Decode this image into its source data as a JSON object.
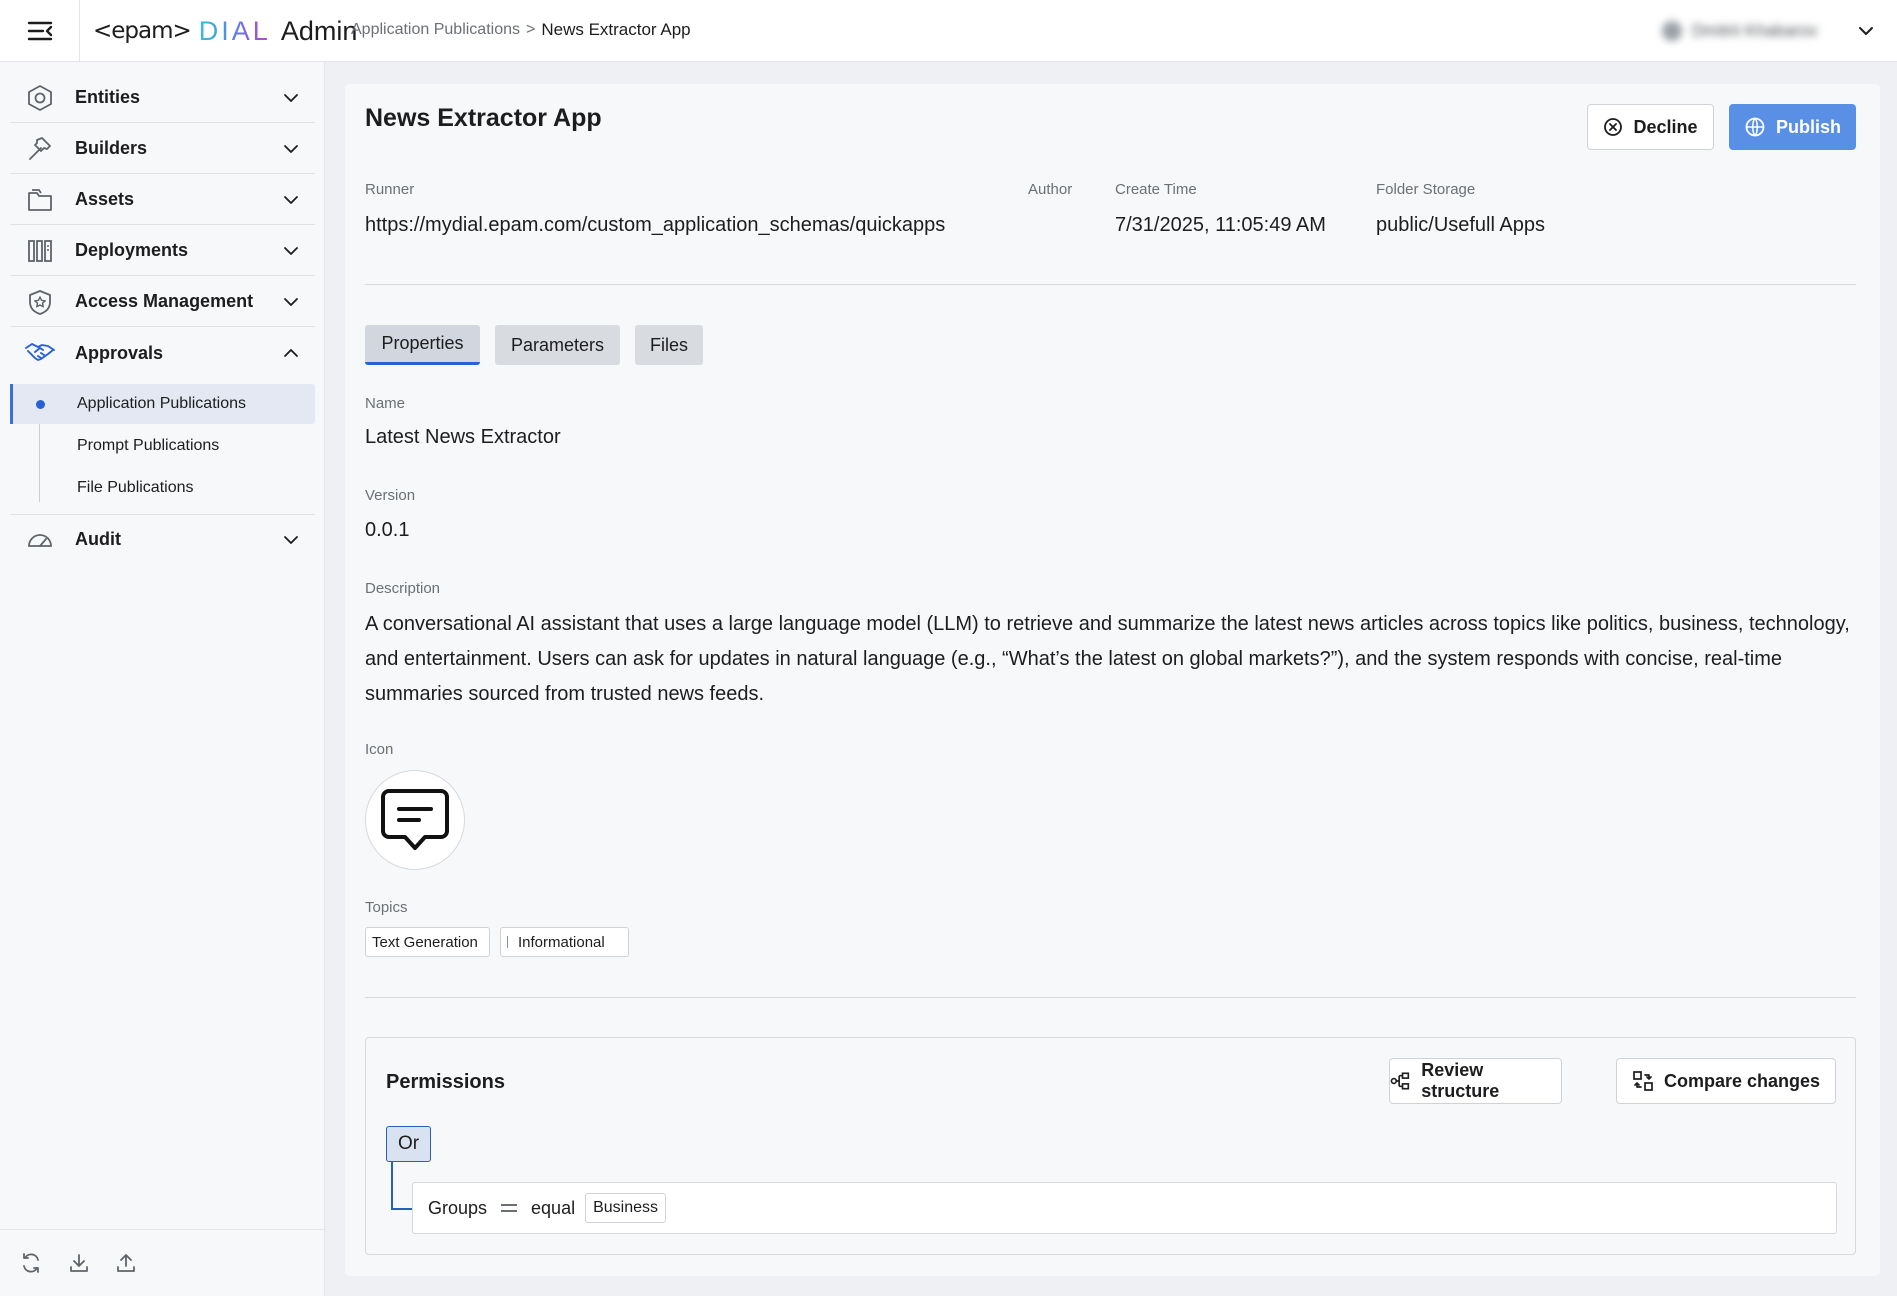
{
  "header": {
    "logo_epam": "<epam>",
    "logo_dial": "DIAL",
    "logo_admin": "Admin",
    "breadcrumb_parent": "Application Publications",
    "breadcrumb_separator": ">",
    "breadcrumb_current": "News Extractor App",
    "user_name": "Dmitrii Khabarov"
  },
  "sidebar": {
    "items": [
      {
        "label": "Entities",
        "icon": "hexagon-icon"
      },
      {
        "label": "Builders",
        "icon": "hammer-icon"
      },
      {
        "label": "Assets",
        "icon": "folder-icon"
      },
      {
        "label": "Deployments",
        "icon": "deployments-icon"
      },
      {
        "label": "Access Management",
        "icon": "shield-star-icon"
      },
      {
        "label": "Approvals",
        "icon": "handshake-icon"
      },
      {
        "label": "Audit",
        "icon": "gauge-icon"
      }
    ],
    "approvals_sub": [
      {
        "label": "Application Publications",
        "active": true
      },
      {
        "label": "Prompt Publications",
        "active": false
      },
      {
        "label": "File Publications",
        "active": false
      }
    ]
  },
  "detail": {
    "title": "News Extractor App",
    "decline_label": "Decline",
    "publish_label": "Publish",
    "meta": {
      "runner_label": "Runner",
      "runner_value": "https://mydial.epam.com/custom_application_schemas/quickapps",
      "author_label": "Author",
      "author_value": "",
      "create_time_label": "Create Time",
      "create_time_value": "7/31/2025, 11:05:49 AM",
      "folder_label": "Folder Storage",
      "folder_value": "public/Usefull Apps"
    },
    "tabs": [
      {
        "label": "Properties",
        "active": true
      },
      {
        "label": "Parameters",
        "active": false
      },
      {
        "label": "Files",
        "active": false
      }
    ],
    "fields": {
      "name_label": "Name",
      "name_value": "Latest News Extractor",
      "version_label": "Version",
      "version_value": "0.0.1",
      "description_label": "Description",
      "description_value": "A conversational AI assistant that uses a large language model (LLM) to retrieve and summarize the latest news articles across topics like politics, business, technology, and entertainment. Users can ask for updates in natural language (e.g., “What’s the latest on global markets?”), and the system responds with concise, real-time summaries sourced from trusted news feeds.",
      "icon_label": "Icon",
      "icon_name": "chat-message-icon",
      "topics_label": "Topics",
      "topics": [
        "Text Generation",
        "Informational"
      ]
    },
    "permissions": {
      "title": "Permissions",
      "review_label": "Review structure",
      "compare_label": "Compare changes",
      "operator": "Or",
      "rule": {
        "field": "Groups",
        "op": "equal",
        "value": "Business"
      }
    }
  },
  "colors": {
    "accent": "#2860d6",
    "publish_bg": "#5a8fe6",
    "tree_line": "#2a5fb8"
  }
}
